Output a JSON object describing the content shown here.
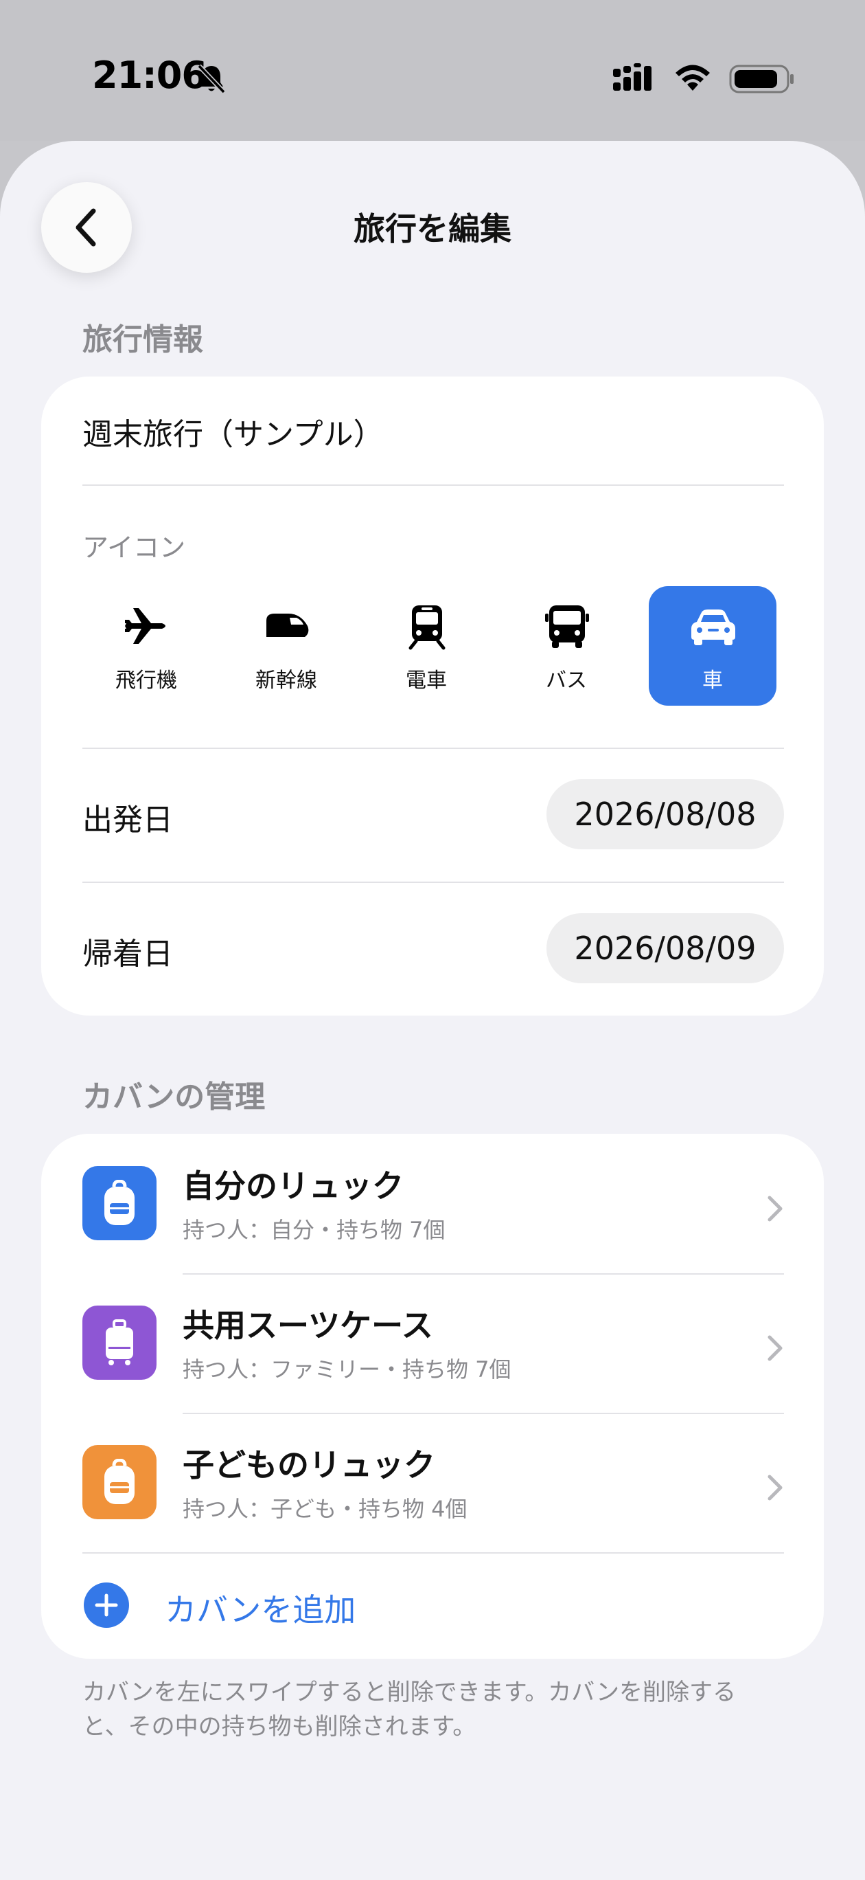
{
  "status": {
    "time": "21:06"
  },
  "nav": {
    "title": "旅行を編集"
  },
  "trip_info": {
    "section_title": "旅行情報",
    "name": "週末旅行（サンプル）",
    "icon_title": "アイコン",
    "icons": [
      {
        "label": "飛行機",
        "icon": "airplane-icon",
        "selected": false
      },
      {
        "label": "新幹線",
        "icon": "shinkansen-icon",
        "selected": false
      },
      {
        "label": "電車",
        "icon": "train-icon",
        "selected": false
      },
      {
        "label": "バス",
        "icon": "bus-icon",
        "selected": false
      },
      {
        "label": "車",
        "icon": "car-icon",
        "selected": true
      }
    ],
    "departure_label": "出発日",
    "departure_date": "2026/08/08",
    "return_label": "帰着日",
    "return_date": "2026/08/09"
  },
  "bags": {
    "section_title": "カバンの管理",
    "items": [
      {
        "title": "自分のリュック",
        "subtitle": "持つ人：自分・持ち物 7個",
        "color": "#3478e8",
        "icon": "backpack-icon"
      },
      {
        "title": "共用スーツケース",
        "subtitle": "持つ人：ファミリー・持ち物 7個",
        "color": "#8e56d4",
        "icon": "suitcase-icon"
      },
      {
        "title": "子どものリュック",
        "subtitle": "持つ人：子ども・持ち物 4個",
        "color": "#f0923a",
        "icon": "backpack-icon"
      }
    ],
    "add_label": "カバンを追加",
    "footnote": "カバンを左にスワイプすると削除できます。カバンを削除すると、その中の持ち物も削除されます。"
  },
  "colors": {
    "accent": "#3478e8",
    "background": "#f2f2f7"
  }
}
